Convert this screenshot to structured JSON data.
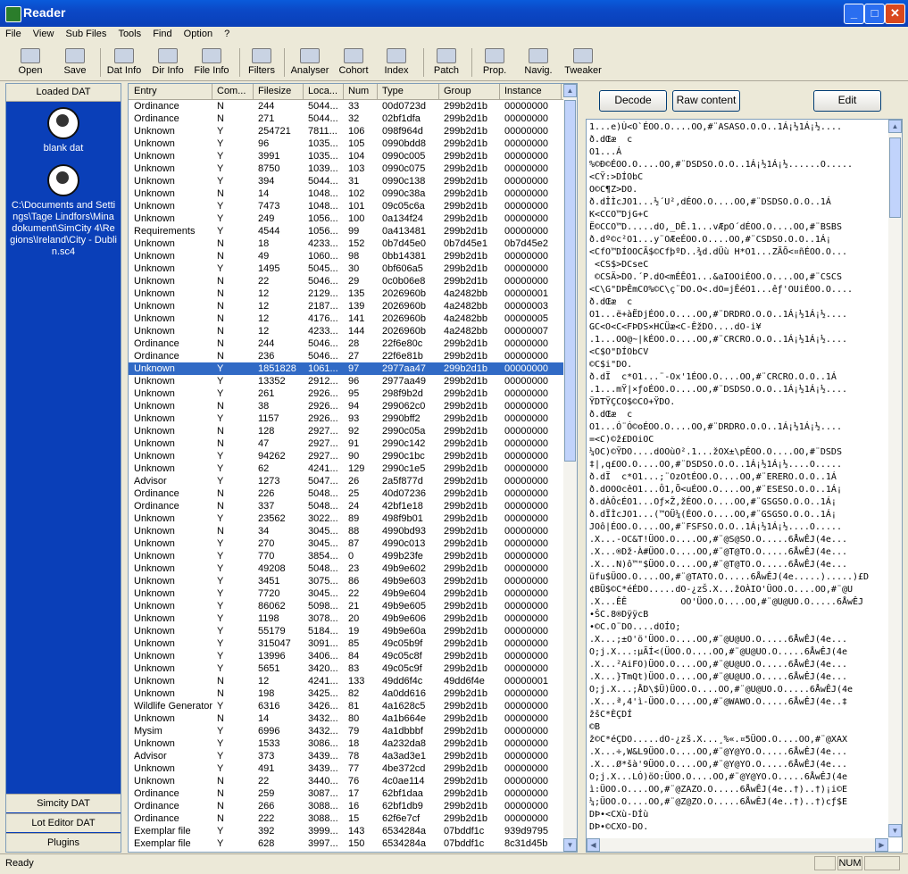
{
  "window": {
    "title": "Reader"
  },
  "menu": [
    "File",
    "View",
    "Sub Files",
    "Tools",
    "Find",
    "Option",
    "?"
  ],
  "toolbar": [
    {
      "label": "Open",
      "icon": "open-folder-icon"
    },
    {
      "label": "Save",
      "icon": "save-icon"
    },
    {
      "label": "Dat Info",
      "icon": "dat-info-icon"
    },
    {
      "label": "Dir Info",
      "icon": "dir-info-icon"
    },
    {
      "label": "File Info",
      "icon": "file-info-icon"
    },
    {
      "label": "Filters",
      "icon": "filters-icon"
    },
    {
      "label": "Analyser",
      "icon": "analyser-icon"
    },
    {
      "label": "Cohort",
      "icon": "cohort-icon"
    },
    {
      "label": "Index",
      "icon": "index-icon"
    },
    {
      "label": "Patch",
      "icon": "patch-icon"
    },
    {
      "label": "Prop.",
      "icon": "properties-icon"
    },
    {
      "label": "Navig.",
      "icon": "navigator-icon"
    },
    {
      "label": "Tweaker",
      "icon": "tweaker-icon"
    }
  ],
  "left_panel": {
    "header": "Loaded DAT",
    "items": [
      {
        "label": "blank dat"
      },
      {
        "label": "C:\\Documents and Settings\\Tage Lindfors\\Mina dokument\\SimCity 4\\Regions\\Ireland\\City - Dublin.sc4"
      }
    ],
    "tabs": [
      "Simcity DAT",
      "Lot Editor DAT",
      "Plugins"
    ]
  },
  "list": {
    "columns": [
      "Entry",
      "Com...",
      "Filesize",
      "Loca...",
      "Num",
      "Type",
      "Group",
      "Instance"
    ],
    "selected_index": 21,
    "rows": [
      [
        "Ordinance",
        "N",
        "244",
        "5044...",
        "33",
        "00d0723d",
        "299b2d1b",
        "00000000"
      ],
      [
        "Ordinance",
        "N",
        "271",
        "5044...",
        "32",
        "02bf1dfa",
        "299b2d1b",
        "00000000"
      ],
      [
        "Unknown",
        "Y",
        "254721",
        "7811...",
        "106",
        "098f964d",
        "299b2d1b",
        "00000000"
      ],
      [
        "Unknown",
        "Y",
        "96",
        "1035...",
        "105",
        "0990bdd8",
        "299b2d1b",
        "00000000"
      ],
      [
        "Unknown",
        "Y",
        "3991",
        "1035...",
        "104",
        "0990c005",
        "299b2d1b",
        "00000000"
      ],
      [
        "Unknown",
        "Y",
        "8750",
        "1039...",
        "103",
        "0990c075",
        "299b2d1b",
        "00000000"
      ],
      [
        "Unknown",
        "Y",
        "394",
        "5044...",
        "31",
        "0990c138",
        "299b2d1b",
        "00000000"
      ],
      [
        "Unknown",
        "N",
        "14",
        "1048...",
        "102",
        "0990c38a",
        "299b2d1b",
        "00000000"
      ],
      [
        "Unknown",
        "Y",
        "7473",
        "1048...",
        "101",
        "09c05c6a",
        "299b2d1b",
        "00000000"
      ],
      [
        "Unknown",
        "Y",
        "249",
        "1056...",
        "100",
        "0a134f24",
        "299b2d1b",
        "00000000"
      ],
      [
        "Requirements",
        "Y",
        "4544",
        "1056...",
        "99",
        "0a413481",
        "299b2d1b",
        "00000000"
      ],
      [
        "Unknown",
        "N",
        "18",
        "4233...",
        "152",
        "0b7d45e0",
        "0b7d45e1",
        "0b7d45e2"
      ],
      [
        "Unknown",
        "N",
        "49",
        "1060...",
        "98",
        "0bb14381",
        "299b2d1b",
        "00000000"
      ],
      [
        "Unknown",
        "Y",
        "1495",
        "5045...",
        "30",
        "0bf606a5",
        "299b2d1b",
        "00000000"
      ],
      [
        "Unknown",
        "N",
        "22",
        "5046...",
        "29",
        "0c0b06e8",
        "299b2d1b",
        "00000000"
      ],
      [
        "Unknown",
        "N",
        "12",
        "2129...",
        "135",
        "2026960b",
        "4a2482bb",
        "00000001"
      ],
      [
        "Unknown",
        "N",
        "12",
        "2187...",
        "139",
        "2026960b",
        "4a2482bb",
        "00000003"
      ],
      [
        "Unknown",
        "N",
        "12",
        "4176...",
        "141",
        "2026960b",
        "4a2482bb",
        "00000005"
      ],
      [
        "Unknown",
        "N",
        "12",
        "4233...",
        "144",
        "2026960b",
        "4a2482bb",
        "00000007"
      ],
      [
        "Ordinance",
        "N",
        "244",
        "5046...",
        "28",
        "22f6e80c",
        "299b2d1b",
        "00000000"
      ],
      [
        "Ordinance",
        "N",
        "236",
        "5046...",
        "27",
        "22f6e81b",
        "299b2d1b",
        "00000000"
      ],
      [
        "Unknown",
        "Y",
        "1851828",
        "1061...",
        "97",
        "2977aa47",
        "299b2d1b",
        "00000000"
      ],
      [
        "Unknown",
        "Y",
        "13352",
        "2912...",
        "96",
        "2977aa49",
        "299b2d1b",
        "00000000"
      ],
      [
        "Unknown",
        "Y",
        "261",
        "2926...",
        "95",
        "298f9b2d",
        "299b2d1b",
        "00000000"
      ],
      [
        "Unknown",
        "N",
        "38",
        "2926...",
        "94",
        "299062c0",
        "299b2d1b",
        "00000000"
      ],
      [
        "Unknown",
        "Y",
        "1157",
        "2926...",
        "93",
        "2990bff2",
        "299b2d1b",
        "00000000"
      ],
      [
        "Unknown",
        "N",
        "128",
        "2927...",
        "92",
        "2990c05a",
        "299b2d1b",
        "00000000"
      ],
      [
        "Unknown",
        "N",
        "47",
        "2927...",
        "91",
        "2990c142",
        "299b2d1b",
        "00000000"
      ],
      [
        "Unknown",
        "Y",
        "94262",
        "2927...",
        "90",
        "2990c1bc",
        "299b2d1b",
        "00000000"
      ],
      [
        "Unknown",
        "Y",
        "62",
        "4241...",
        "129",
        "2990c1e5",
        "299b2d1b",
        "00000000"
      ],
      [
        "Advisor",
        "Y",
        "1273",
        "5047...",
        "26",
        "2a5f877d",
        "299b2d1b",
        "00000000"
      ],
      [
        "Ordinance",
        "N",
        "226",
        "5048...",
        "25",
        "40d07236",
        "299b2d1b",
        "00000000"
      ],
      [
        "Ordinance",
        "N",
        "337",
        "5048...",
        "24",
        "42bf1e18",
        "299b2d1b",
        "00000000"
      ],
      [
        "Unknown",
        "Y",
        "23562",
        "3022...",
        "89",
        "498f9b01",
        "299b2d1b",
        "00000000"
      ],
      [
        "Unknown",
        "N",
        "34",
        "3045...",
        "88",
        "4990bd93",
        "299b2d1b",
        "00000000"
      ],
      [
        "Unknown",
        "Y",
        "270",
        "3045...",
        "87",
        "4990c013",
        "299b2d1b",
        "00000000"
      ],
      [
        "Unknown",
        "Y",
        "770",
        "3854...",
        "0",
        "499b23fe",
        "299b2d1b",
        "00000000"
      ],
      [
        "Unknown",
        "Y",
        "49208",
        "5048...",
        "23",
        "49b9e602",
        "299b2d1b",
        "00000000"
      ],
      [
        "Unknown",
        "Y",
        "3451",
        "3075...",
        "86",
        "49b9e603",
        "299b2d1b",
        "00000000"
      ],
      [
        "Unknown",
        "Y",
        "7720",
        "3045...",
        "22",
        "49b9e604",
        "299b2d1b",
        "00000000"
      ],
      [
        "Unknown",
        "Y",
        "86062",
        "5098...",
        "21",
        "49b9e605",
        "299b2d1b",
        "00000000"
      ],
      [
        "Unknown",
        "Y",
        "1198",
        "3078...",
        "20",
        "49b9e606",
        "299b2d1b",
        "00000000"
      ],
      [
        "Unknown",
        "Y",
        "55179",
        "5184...",
        "19",
        "49b9e60a",
        "299b2d1b",
        "00000000"
      ],
      [
        "Unknown",
        "Y",
        "315047",
        "3091...",
        "85",
        "49c05b9f",
        "299b2d1b",
        "00000000"
      ],
      [
        "Unknown",
        "Y",
        "13996",
        "3406...",
        "84",
        "49c05c8f",
        "299b2d1b",
        "00000000"
      ],
      [
        "Unknown",
        "Y",
        "5651",
        "3420...",
        "83",
        "49c05c9f",
        "299b2d1b",
        "00000000"
      ],
      [
        "Unknown",
        "N",
        "12",
        "4241...",
        "133",
        "49dd6f4c",
        "49dd6f4e",
        "00000001"
      ],
      [
        "Unknown",
        "N",
        "198",
        "3425...",
        "82",
        "4a0dd616",
        "299b2d1b",
        "00000000"
      ],
      [
        "Wildlife Generator",
        "Y",
        "6316",
        "3426...",
        "81",
        "4a1628c5",
        "299b2d1b",
        "00000000"
      ],
      [
        "Unknown",
        "N",
        "14",
        "3432...",
        "80",
        "4a1b664e",
        "299b2d1b",
        "00000000"
      ],
      [
        "Mysim",
        "Y",
        "6996",
        "3432...",
        "79",
        "4a1dbbbf",
        "299b2d1b",
        "00000000"
      ],
      [
        "Unknown",
        "Y",
        "1533",
        "3086...",
        "18",
        "4a232da8",
        "299b2d1b",
        "00000000"
      ],
      [
        "Advisor",
        "Y",
        "373",
        "3439...",
        "78",
        "4a3ad3e1",
        "299b2d1b",
        "00000000"
      ],
      [
        "Unknown",
        "Y",
        "491",
        "3439...",
        "77",
        "4be372cd",
        "299b2d1b",
        "00000000"
      ],
      [
        "Unknown",
        "N",
        "22",
        "3440...",
        "76",
        "4c0ae114",
        "299b2d1b",
        "00000000"
      ],
      [
        "Ordinance",
        "N",
        "259",
        "3087...",
        "17",
        "62bf1daa",
        "299b2d1b",
        "00000000"
      ],
      [
        "Ordinance",
        "N",
        "266",
        "3088...",
        "16",
        "62bf1db9",
        "299b2d1b",
        "00000000"
      ],
      [
        "Ordinance",
        "N",
        "222",
        "3088...",
        "15",
        "62f6e7cf",
        "299b2d1b",
        "00000000"
      ],
      [
        "Exemplar file",
        "Y",
        "392",
        "3999...",
        "143",
        "6534284a",
        "07bddf1c",
        "939d9795"
      ],
      [
        "Exemplar file",
        "Y",
        "628",
        "3997...",
        "150",
        "6534284a",
        "07bddf1c",
        "8c31d45b"
      ]
    ]
  },
  "right_panel": {
    "buttons": {
      "decode": "Decode",
      "raw": "Raw content",
      "edit": "Edit"
    },
    "hex_lines": [
      "1...e)Ù<O`ÉOO.O....OO,#¨ASASO.O.O..1Á¡½1Á¡½....",
      "ð.dŒæ  c",
      "O1...Á",
      "%©Ð©ÉOO.O....OO,#¨DSDSO.O.O..1Á¡½1Á¡½......O.....",
      "<CŸ:>DÍObC",
      "O©C¶Z>DO.",
      "ð.dÎÌcJO1...½´U²,dÉOO.O....OO,#¨DSDSO.O.O..1Á",
      "K<CCO™DjG+C",
      "Ë©CCO™D.....dO,_DÊ.1...vÆpO´dÉOO.O....OO,#¨BSBS",
      "ð.dº©c²O1...y¨OÆeÉOO.O....OO,#¨CSDSO.O.O..1Á¡",
      "<CfO™DÍOOCÃ$©CfþºD..¾d.dÜù H*O1...ZÃÕ<¤ñÉOO.O...",
      " <CS$>DCseC",
      " ©CSÄ>DO.´P.dO<mÉÊO1...&aIOOiÉOO.O....OO,#¨CSCS",
      "<C\\G\"DÞÊmCO%©C\\ç¨DO.O<.dO=jÊéO1...êƒ'OUiÉOO.O....",
      "ð.dŒæ  c",
      "O1...ë+àËDjÉOO.O....OO,#¨DRDRO.O.O..1Á¡½1Á¡½....",
      "GC<O<C<FÞDS×HCÜæ<C-ÊžDO....dO-i¥",
      ".1...OO@~|kÉOO.O....OO,#¨CRCRO.O.O..1Á¡½1Á¡½....",
      "<C$O\"DÍObCV",
      "©C$i\"DO.",
      "ð.dÏ  c*O1...¨-Ox'1ÉOO.O....OO,#¨CRCRO.O.O..1Á",
      ".1...mŸ|×ƒoÉOO.O....OO,#¨DSDSO.O.O..1Á¡½1Á¡½....",
      "ŸDTŸÇCO$©CO+ŸDO.",
      "ð.dŒæ  c",
      "O1...Ó¨Ó©oÉOO.O....OO,#¨DRDRO.O.O..1Á¡½1Á¡½....",
      "=<C)©ž£DOiOC",
      "¼OC)©ŸDO....dOOùO².1...žOX±\\pÉOO.O....OO,#¨DSDS",
      "‡|,q£OO.O....OO,#¨DSDSO.O.O..1Á¡½1Á¡½....O.....",
      "ð.dÏ  c*O1...;¨OzOtÉOO.O....OO,#¨ERERO.O.O..1Á",
      "ð.dOOOcêO1...Ô1,Õ<uÉOO.O....OO,#¨ESESO.O.O..1Á¡",
      "ð.dÀÔcÉO1...Oƒ×Ž,žÉOO.O....OO,#¨GSGSO.O.O..1Á¡",
      "ð.dÏÌcJO1...(™OÜ¼(ÉOO.O....OO,#¨GSGSO.O.O..1Á¡",
      "JOô|ÉOO.O....OO,#¨FSFSO.O.O..1Á¡½1Á¡½....O.....",
      ".X...-OC&T!ÜOO.O....OO,#¨@S@SO.O.....6ÅwÊJ(4e...",
      ".X...®Dž·À#ÜOO.O....OO,#¨@T@TO.O.....6ÅwÊJ(4e...",
      ".X...N)ô™\"$ÜOO.O....OO,#¨@T@TO.O.....6ÅwÊJ(4e...",
      "üfu$ÜOO.O....OO,#¨@TATO.O.....6ÅwÊJ(4e.....).....)£D",
      "¢BÜ$©C*éÉDO.....dO-¿zŠ.X...žOÀIO'ÜOO.O....OO,#¨@U",
      ".X...ÊÊ          OO'ÜOO.O....OO,#¨@U@UO.O.....6ÅwÊJ",
      "•ŠC.8®DÿÿcB",
      "•©C.O¨DO....dOÍO;",
      ".X...;±O'ö'ÜOO.O....OO,#¨@U@UO.O.....6ÅwÊJ(4e...",
      "O;j.X...:µÃÍ<(ÜOO.O....OO,#¨@U@UO.O.....6ÅwÊJ(4e",
      ".X...²AiFO)ÜOO.O....OO,#¨@U@UO.O.....6ÅwÊJ(4e...",
      ".X...}TmQt)ÜOO.O....OO,#¨@U@UO.O.....6ÅwÊJ(4e...",
      "O;j.X...;ÅD\\$Ü)ÜOO.O....OO,#¨@U@UO.O.....6ÅwÊJ(4e",
      ".X...ª,4'ì-ÜOO.O....OO,#¨@WAWO.O.....6ÅwÊJ(4e..‡",
      "žšC*ÈÇDÍ",
      "©B",
      "ž©C*éÇDO.....dO-¿zš.X...¸%«.¤5ÜOO.O....OO,#¨@XAX",
      ".X...÷,W&L9ÜOO.O....OO,#¨@Y@YO.O.....6ÅwÊJ(4e...",
      ".X...Ø*šà'9ÜOO.O....OO,#¨@Y@YO.O.....6ÅwÊJ(4e...",
      "O;j.X...LÓ)öO:ÜOO.O....OO,#¨@Y@YO.O.....6ÅwÊJ(4e",
      "ì:ÜOO.O....OO,#¨@ZAZO.O.....6ÅwÊJ(4e..†)..†)¡i©E",
      "¼;ÜOO.O....OO,#¨@Z@ZO.O.....6ÅwÊJ(4e..†)..†)cƒ$E",
      "DÞ•<CXù-DÍù",
      "DÞ•©CXO-DO."
    ]
  },
  "status": {
    "text": "Ready",
    "num": "NUM"
  }
}
